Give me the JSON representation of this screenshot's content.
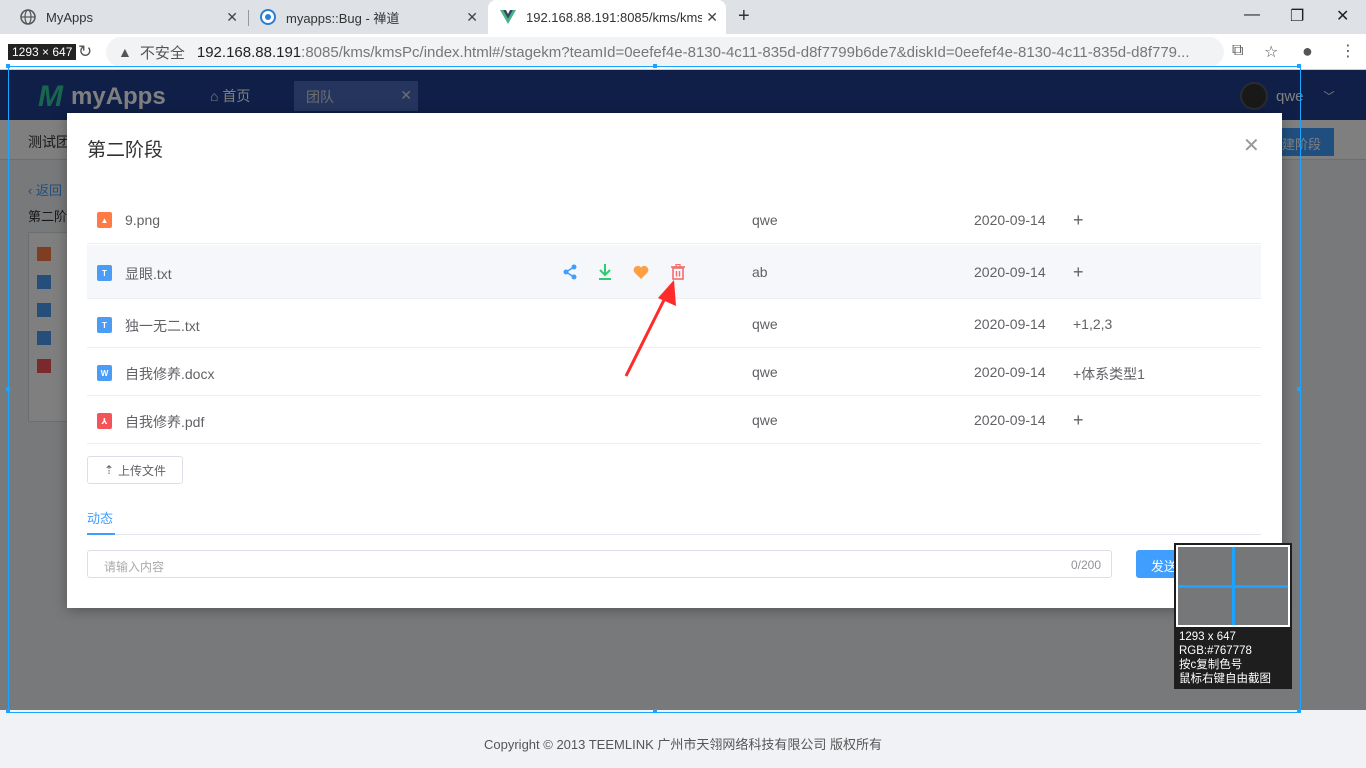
{
  "browser": {
    "tabs": [
      {
        "title": "MyApps",
        "icon": "globe-icon"
      },
      {
        "title": "myapps::Bug - 禅道",
        "icon": "zentao-icon"
      },
      {
        "title": "192.168.88.191:8085/kms/kms",
        "icon": "vue-icon"
      }
    ],
    "new_tab_glyph": "+",
    "insecure_label": "不安全",
    "url_host": "192.168.88.191",
    "url_rest": ":8085/kms/kmsPc/index.html#/stagekm?teamId=0eefef4e-8130-4c11-835d-d8f7799b6de7&diskId=0eefef4e-8130-4c11-835d-d8f779...",
    "dimension_label": "1293 × 647"
  },
  "app": {
    "logo_text": "myApps",
    "nav_home": "首页",
    "nav_team": "团队",
    "username": "qwe",
    "team_title": "测试团",
    "new_stage_button": "建阶段",
    "back_link": "返回",
    "stage_label": "第二阶",
    "footer": "Copyright © 2013 TEEMLINK 广州市天翎网络科技有限公司 版权所有"
  },
  "modal": {
    "title": "第二阶段",
    "files": [
      {
        "name": "9.png",
        "type": "image",
        "owner": "qwe",
        "date": "2020-09-14",
        "tag": "+"
      },
      {
        "name": "显眼.txt",
        "type": "txt",
        "owner": "ab",
        "date": "2020-09-14",
        "tag": "+"
      },
      {
        "name": "独一无二.txt",
        "type": "txt",
        "owner": "qwe",
        "date": "2020-09-14",
        "tag": "+1,2,3"
      },
      {
        "name": "自我修养.docx",
        "type": "docx",
        "owner": "qwe",
        "date": "2020-09-14",
        "tag": "+体系类型1"
      },
      {
        "name": "自我修养.pdf",
        "type": "pdf",
        "owner": "qwe",
        "date": "2020-09-14",
        "tag": "+"
      }
    ],
    "upload_button": "上传文件",
    "activity_tab": "动态",
    "comment_placeholder": "请输入内容",
    "comment_count": "0/200",
    "send_button": "发送"
  },
  "magnifier": {
    "line1": "1293 x 647",
    "line2": "RGB:#767778",
    "line3": "按c复制色号",
    "line4": "鼠标右键自由截图"
  },
  "colors": {
    "accent": "#409eff",
    "header": "#1e3f8f",
    "image_icon": "#ff7a45",
    "txt_icon": "#4a9cf5",
    "pdf_icon": "#f5535a",
    "delete_icon": "#f56c6c",
    "download_icon": "#2ecc71",
    "favorite_icon": "#ff9f43",
    "annotation_arrow": "#ff2a2a"
  }
}
